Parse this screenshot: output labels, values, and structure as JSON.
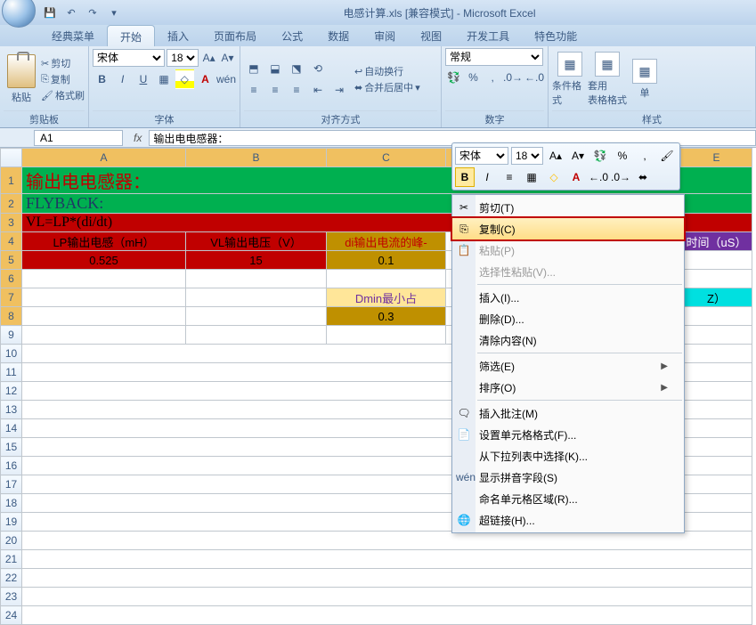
{
  "title": "电感计算.xls [兼容模式] - Microsoft Excel",
  "tabs": [
    "经典菜单",
    "开始",
    "插入",
    "页面布局",
    "公式",
    "数据",
    "审阅",
    "视图",
    "开发工具",
    "特色功能"
  ],
  "active_tab": 1,
  "clipboard": {
    "label": "剪贴板",
    "paste": "粘贴",
    "cut": "剪切",
    "copy": "复制",
    "format_painter": "格式刷"
  },
  "font_group": {
    "label": "字体",
    "font": "宋体",
    "size": "18"
  },
  "align_group": {
    "label": "对齐方式",
    "wrap": "自动换行",
    "merge": "合并后居中"
  },
  "number_group": {
    "label": "数字",
    "format": "常规"
  },
  "styles_group": {
    "label": "样式",
    "cond": "条件格式",
    "table": "套用\n表格格式",
    "cell": "单元格样式"
  },
  "namebox": "A1",
  "formula": "输出电电感器：",
  "mini": {
    "font": "宋体",
    "size": "18"
  },
  "columns": [
    "A",
    "B",
    "C",
    "D",
    "E"
  ],
  "rows": {
    "r1": {
      "a": "输出电电感器："
    },
    "r2": {
      "a": "FLYBACK:"
    },
    "r3": {
      "a": "VL=LP*(di/dt)"
    },
    "r4": {
      "a": "LP输出电感（mH）",
      "b": "VL输出电压（V）",
      "c": "di输出电流的峰-",
      "e": "时间（uS）"
    },
    "r5": {
      "a": "0.525",
      "b": "15",
      "c": "0.1"
    },
    "r7": {
      "c": "Dmin最小占",
      "e": "Z）"
    },
    "r8": {
      "c": "0.3"
    }
  },
  "ctx": {
    "cut": "剪切(T)",
    "copy": "复制(C)",
    "paste": "粘贴(P)",
    "paste_special": "选择性粘贴(V)...",
    "insert": "插入(I)...",
    "delete": "删除(D)...",
    "clear": "清除内容(N)",
    "filter": "筛选(E)",
    "sort": "排序(O)",
    "comment": "插入批注(M)",
    "format_cells": "设置单元格格式(F)...",
    "pick_list": "从下拉列表中选择(K)...",
    "phonetic": "显示拼音字段(S)",
    "name_range": "命名单元格区域(R)...",
    "hyperlink": "超链接(H)..."
  },
  "colors": {
    "accent": "#3b5a82"
  }
}
